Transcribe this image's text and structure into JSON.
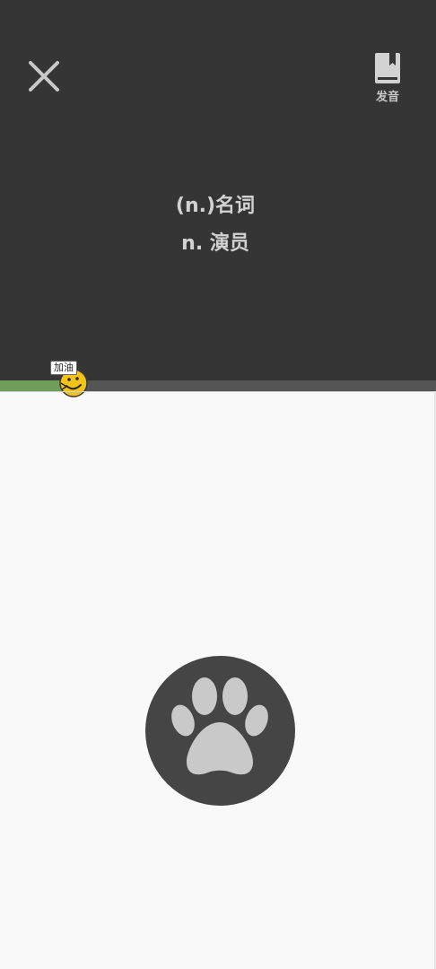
{
  "header": {
    "close_icon": "close-icon",
    "pronunciation_icon": "bookmark-book-icon",
    "pronunciation_label": "发音"
  },
  "word": {
    "part_of_speech": "(n.)名词",
    "definition": "n. 演员"
  },
  "progress": {
    "fraction": 0.15,
    "fill_color": "#6f9e5a",
    "track_color": "#555555",
    "mascot_label": "加油",
    "mascot_icon": "cheering-face-icon"
  },
  "action": {
    "paw_icon": "paw-icon",
    "button_color": "#454545",
    "paw_color": "#c9c9c9"
  },
  "colors": {
    "top_panel_bg": "#353535",
    "page_bg": "#f9f9f9"
  }
}
